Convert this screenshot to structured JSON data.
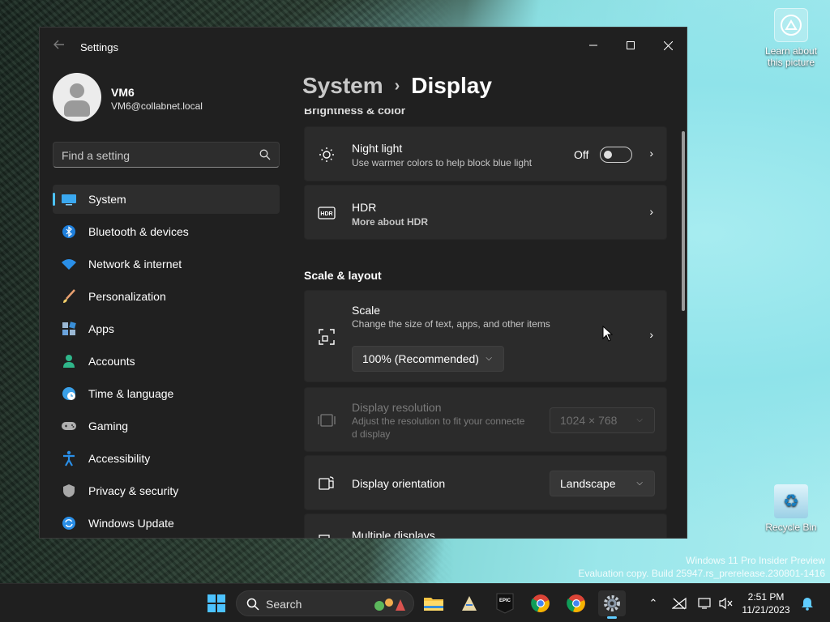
{
  "desktop": {
    "icons": {
      "learn": "Learn about this picture",
      "recycle": "Recycle Bin"
    },
    "watermark": {
      "line1": "Windows 11 Pro Insider Preview",
      "line2": "Evaluation copy. Build 25947.rs_prerelease.230801-1416"
    }
  },
  "window": {
    "title": "Settings",
    "user": {
      "name": "VM6",
      "email": "VM6@collabnet.local"
    },
    "search": {
      "placeholder": "Find a setting"
    },
    "nav": [
      {
        "label": "System",
        "icon": "system-icon",
        "active": true
      },
      {
        "label": "Bluetooth & devices",
        "icon": "bluetooth-icon"
      },
      {
        "label": "Network & internet",
        "icon": "wifi-icon"
      },
      {
        "label": "Personalization",
        "icon": "brush-icon"
      },
      {
        "label": "Apps",
        "icon": "apps-icon"
      },
      {
        "label": "Accounts",
        "icon": "accounts-icon"
      },
      {
        "label": "Time & language",
        "icon": "globe-clock-icon"
      },
      {
        "label": "Gaming",
        "icon": "gamepad-icon"
      },
      {
        "label": "Accessibility",
        "icon": "accessibility-icon"
      },
      {
        "label": "Privacy & security",
        "icon": "shield-icon"
      },
      {
        "label": "Windows Update",
        "icon": "update-icon"
      }
    ],
    "breadcrumb": {
      "parent": "System",
      "separator": "›",
      "current": "Display"
    },
    "partial_heading": "Brightness & color",
    "night_light": {
      "title": "Night light",
      "subtitle": "Use warmer colors to help block blue light",
      "state": "Off"
    },
    "hdr": {
      "title": "HDR",
      "link": "More about HDR"
    },
    "scale_layout_heading": "Scale & layout",
    "scale": {
      "title": "Scale",
      "subtitle": "Change the size of text, apps, and other items",
      "value": "100% (Recommended)"
    },
    "resolution": {
      "title": "Display resolution",
      "subtitle_line1": "Adjust the resolution to fit your connecte",
      "subtitle_line2": "d display",
      "value": "1024 × 768"
    },
    "orientation": {
      "title": "Display orientation",
      "value": "Landscape"
    },
    "multiple": {
      "title": "Multiple displays"
    }
  },
  "taskbar": {
    "search_label": "Search",
    "time": "2:51 PM",
    "date": "11/21/2023"
  },
  "colors": {
    "accent": "#4cc2ff",
    "link": "#99ebff",
    "window_bg": "#202020",
    "card_bg": "#2b2b2b"
  }
}
